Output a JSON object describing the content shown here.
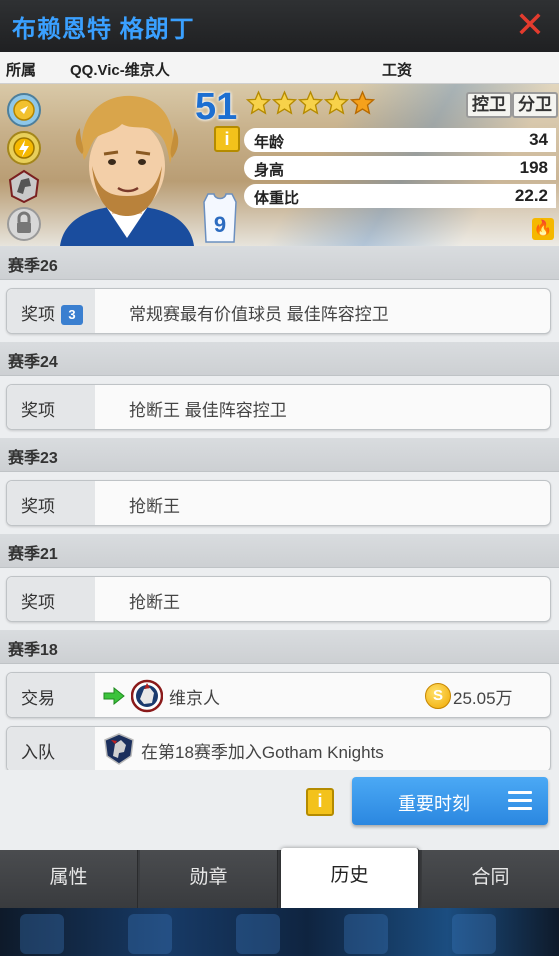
{
  "header": {
    "title": "布赖恩特 格朗丁",
    "close_icon": "close-icon"
  },
  "info_row": {
    "team_label": "所属",
    "team_value": "QQ.Vic-维京人",
    "salary_label": "工资"
  },
  "player": {
    "rating": "51",
    "stars": 5,
    "positions": [
      "控卫",
      "分卫"
    ],
    "info_glyph": "i",
    "jersey_number": "9",
    "stats": [
      {
        "label": "年龄",
        "value": "34"
      },
      {
        "label": "身高",
        "value": "198"
      },
      {
        "label": "体重比",
        "value": "22.2"
      }
    ]
  },
  "history": {
    "seasons": [
      {
        "title": "赛季26",
        "entries": [
          {
            "kind": "奖项",
            "badge": "3",
            "text": "常规赛最有价值球员  最佳阵容控卫"
          }
        ]
      },
      {
        "title": "赛季24",
        "entries": [
          {
            "kind": "奖项",
            "text": "抢断王  最佳阵容控卫"
          }
        ]
      },
      {
        "title": "赛季23",
        "entries": [
          {
            "kind": "奖项",
            "text": "抢断王"
          }
        ]
      },
      {
        "title": "赛季21",
        "entries": [
          {
            "kind": "奖项",
            "text": "抢断王"
          }
        ]
      },
      {
        "title": "赛季18",
        "entries": [
          {
            "kind": "交易",
            "team": "维京人",
            "coin_glyph": "S",
            "amount": "25.05万"
          },
          {
            "kind": "入队",
            "text": "在第18赛季加入Gotham Knights"
          }
        ]
      }
    ]
  },
  "actions": {
    "info_glyph": "i",
    "moments_label": "重要时刻"
  },
  "tabs": [
    {
      "label": "属性",
      "active": false
    },
    {
      "label": "勋章",
      "active": false
    },
    {
      "label": "历史",
      "active": true
    },
    {
      "label": "合同",
      "active": false
    }
  ],
  "colors": {
    "accent_blue": "#2b87e0",
    "title_blue": "#3aa0ff",
    "close_red": "#e33b2e",
    "star_orange": "#f6a11b"
  }
}
